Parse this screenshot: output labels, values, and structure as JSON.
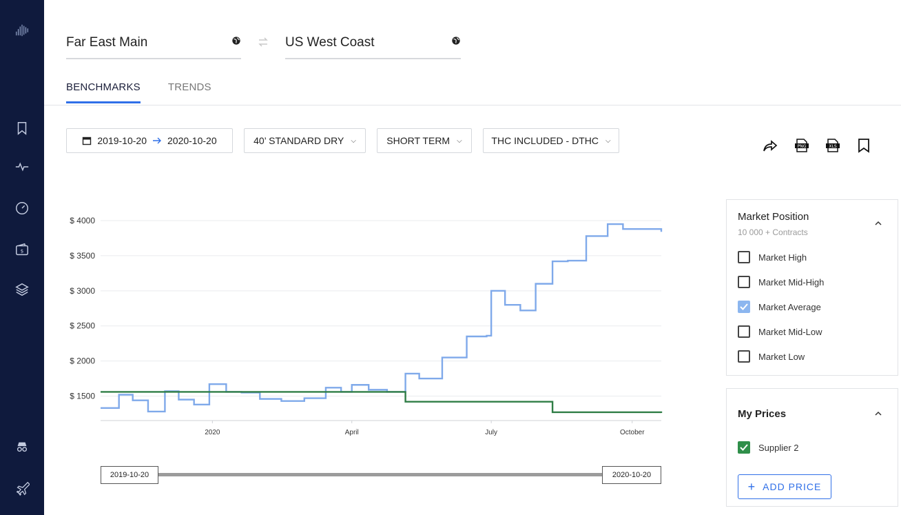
{
  "route": {
    "origin": "Far East Main",
    "destination": "US West Coast"
  },
  "tabs": {
    "benchmarks": "BENCHMARKS",
    "trends": "TRENDS"
  },
  "filters": {
    "date_from": "2019-10-20",
    "date_to": "2020-10-20",
    "container": "40’ STANDARD DRY",
    "term": "SHORT TERM",
    "charges": "THC INCLUDED - DTHC"
  },
  "market_position": {
    "title": "Market Position",
    "subtitle": "10 000 + Contracts",
    "options": [
      {
        "label": "Market High",
        "checked": false
      },
      {
        "label": "Market Mid-High",
        "checked": false
      },
      {
        "label": "Market Average",
        "checked": true
      },
      {
        "label": "Market Mid-Low",
        "checked": false
      },
      {
        "label": "Market Low",
        "checked": false
      }
    ]
  },
  "my_prices": {
    "title": "My Prices",
    "suppliers": [
      {
        "label": "Supplier 2",
        "checked": true
      }
    ],
    "add_label": "ADD PRICE"
  },
  "range": {
    "start": "2019-10-20",
    "end": "2020-10-20"
  },
  "colors": {
    "accent": "#2f6fe8",
    "market_average": "#7fa9ea",
    "supplier": "#2f7d45",
    "sidebar": "#0f1a3d"
  },
  "chart_data": {
    "type": "line",
    "x_ticks": [
      "2020",
      "April",
      "July",
      "October"
    ],
    "y_ticks": [
      "$ 1500",
      "$ 2000",
      "$ 2500",
      "$ 3000",
      "$ 3500",
      "$ 4000"
    ],
    "ylim": [
      1250,
      4000
    ],
    "xlim": [
      "2019-10-20",
      "2020-10-20"
    ],
    "series": [
      {
        "name": "Market Average",
        "x": [
          "2019-10-20",
          "2019-11-01",
          "2019-11-10",
          "2019-11-20",
          "2019-12-01",
          "2019-12-10",
          "2019-12-20",
          "2019-12-30",
          "2020-01-10",
          "2020-01-20",
          "2020-02-01",
          "2020-02-15",
          "2020-03-01",
          "2020-03-15",
          "2020-03-25",
          "2020-04-01",
          "2020-04-12",
          "2020-04-24",
          "2020-05-06",
          "2020-05-15",
          "2020-05-30",
          "2020-06-15",
          "2020-06-28",
          "2020-07-01",
          "2020-07-10",
          "2020-07-20",
          "2020-07-30",
          "2020-08-10",
          "2020-08-20",
          "2020-09-01",
          "2020-09-15",
          "2020-09-25",
          "2020-10-20"
        ],
        "y": [
          1330,
          1520,
          1440,
          1280,
          1570,
          1450,
          1380,
          1670,
          1560,
          1550,
          1460,
          1430,
          1470,
          1620,
          1560,
          1660,
          1590,
          1560,
          1820,
          1750,
          2050,
          2350,
          2360,
          3000,
          2800,
          2720,
          3100,
          3420,
          3430,
          3780,
          3950,
          3880,
          3840
        ]
      },
      {
        "name": "Supplier 2",
        "x": [
          "2019-10-20",
          "2020-05-06",
          "2020-08-10",
          "2020-10-20"
        ],
        "y": [
          1560,
          1420,
          1270,
          1260
        ]
      }
    ]
  }
}
